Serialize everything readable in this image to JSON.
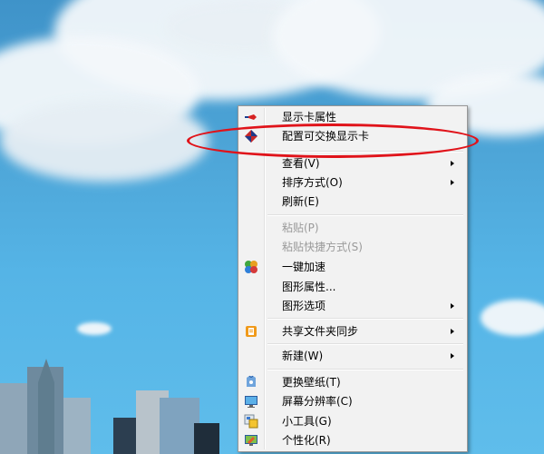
{
  "context_menu": {
    "items": [
      {
        "label": "显示卡属性",
        "icon": "display-properties-icon",
        "enabled": true,
        "submenu": false
      },
      {
        "label": "配置可交换显示卡",
        "icon": "switchable-graphics-icon",
        "enabled": true,
        "submenu": false
      },
      {
        "label": "查看(V)",
        "icon": "",
        "enabled": true,
        "submenu": true
      },
      {
        "label": "排序方式(O)",
        "icon": "",
        "enabled": true,
        "submenu": true
      },
      {
        "label": "刷新(E)",
        "icon": "",
        "enabled": true,
        "submenu": false
      },
      {
        "label": "粘贴(P)",
        "icon": "",
        "enabled": false,
        "submenu": false
      },
      {
        "label": "粘贴快捷方式(S)",
        "icon": "",
        "enabled": false,
        "submenu": false
      },
      {
        "label": "一键加速",
        "icon": "speedup-icon",
        "enabled": true,
        "submenu": false
      },
      {
        "label": "图形属性...",
        "icon": "",
        "enabled": true,
        "submenu": false
      },
      {
        "label": "图形选项",
        "icon": "",
        "enabled": true,
        "submenu": true
      },
      {
        "label": "共享文件夹同步",
        "icon": "folder-sync-icon",
        "enabled": true,
        "submenu": true
      },
      {
        "label": "新建(W)",
        "icon": "",
        "enabled": true,
        "submenu": true
      },
      {
        "label": "更换壁纸(T)",
        "icon": "wallpaper-icon",
        "enabled": true,
        "submenu": false
      },
      {
        "label": "屏幕分辨率(C)",
        "icon": "monitor-icon",
        "enabled": true,
        "submenu": false
      },
      {
        "label": "小工具(G)",
        "icon": "gadgets-icon",
        "enabled": true,
        "submenu": false
      },
      {
        "label": "个性化(R)",
        "icon": "personalize-icon",
        "enabled": true,
        "submenu": false
      }
    ]
  },
  "annotation": {
    "color": "#e0131a",
    "target": "配置可交换显示卡"
  }
}
